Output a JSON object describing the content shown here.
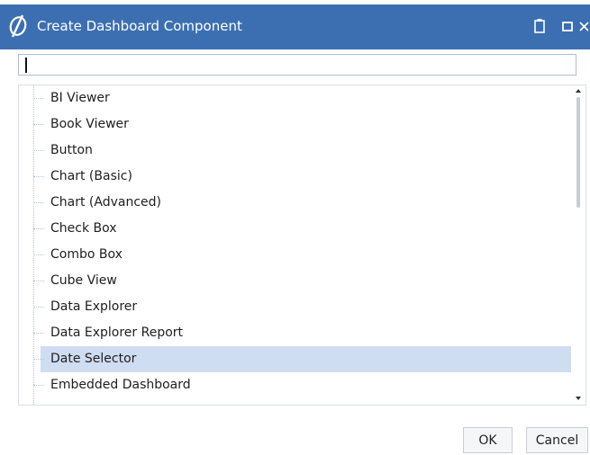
{
  "window": {
    "title": "Create Dashboard Component",
    "logo_icon": "onestream-logo-icon",
    "controls": [
      "clipboard-icon",
      "maximize-icon",
      "close-icon"
    ]
  },
  "search": {
    "value": "",
    "placeholder": ""
  },
  "components": {
    "items": [
      "BI Viewer",
      "Book Viewer",
      "Button",
      "Chart (Basic)",
      "Chart (Advanced)",
      "Check Box",
      "Combo Box",
      "Cube View",
      "Data Explorer",
      "Data Explorer Report",
      "Date Selector",
      "Embedded Dashboard"
    ],
    "selected": "Date Selector"
  },
  "buttons": {
    "ok_label": "OK",
    "cancel_label": "Cancel"
  },
  "colors": {
    "titlebar": "#3c6fb2",
    "selection": "#cfddf2",
    "border": "#a9c0d9"
  }
}
